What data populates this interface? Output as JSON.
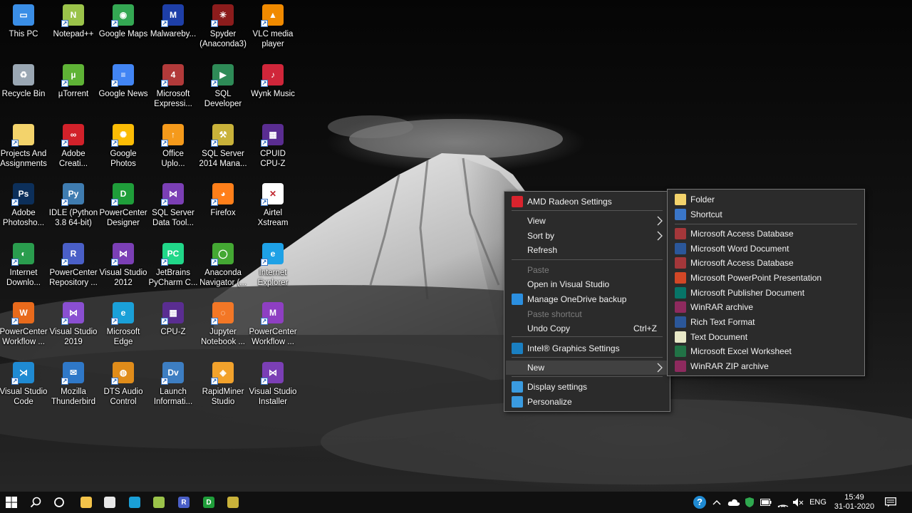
{
  "desktop": {
    "icons": [
      {
        "label": "This PC",
        "icon": "this-pc-icon",
        "color": "#3a8ee6",
        "glyph": "▭"
      },
      {
        "label": "Notepad++",
        "icon": "notepad-plus-plus-icon",
        "color": "#9bc34a",
        "glyph": "N"
      },
      {
        "label": "Google Maps",
        "icon": "google-maps-icon",
        "color": "#34a853",
        "glyph": "◉"
      },
      {
        "label": "Malwareby...",
        "icon": "malwarebytes-icon",
        "color": "#1e3fa8",
        "glyph": "M"
      },
      {
        "label": "Spyder\n(Anaconda3)",
        "icon": "spyder-icon",
        "color": "#8c1c1c",
        "glyph": "✳"
      },
      {
        "label": "VLC media\nplayer",
        "icon": "vlc-icon",
        "color": "#f08a00",
        "glyph": "▲"
      },
      {
        "label": "Recycle Bin",
        "icon": "recycle-bin-icon",
        "color": "#9aa7b3",
        "glyph": "♻"
      },
      {
        "label": "µTorrent",
        "icon": "utorrent-icon",
        "color": "#5fb336",
        "glyph": "µ"
      },
      {
        "label": "Google News",
        "icon": "google-news-icon",
        "color": "#4285f4",
        "glyph": "≡"
      },
      {
        "label": "Microsoft\nExpressi...",
        "icon": "microsoft-expression-icon",
        "color": "#b23a3a",
        "glyph": "4"
      },
      {
        "label": "SQL\nDeveloper",
        "icon": "sql-developer-icon",
        "color": "#2e8b57",
        "glyph": "▶"
      },
      {
        "label": "Wynk Music",
        "icon": "wynk-music-icon",
        "color": "#d0263a",
        "glyph": "♪"
      },
      {
        "label": "Projects And\nAssignments",
        "icon": "folder-icon",
        "color": "#f3d36b",
        "glyph": ""
      },
      {
        "label": "Adobe\nCreati...",
        "icon": "adobe-creative-cloud-icon",
        "color": "#d2212a",
        "glyph": "∞"
      },
      {
        "label": "Google\nPhotos",
        "icon": "google-photos-icon",
        "color": "#fbbc05",
        "glyph": "✺"
      },
      {
        "label": "Office\nUplo...",
        "icon": "office-upload-icon",
        "color": "#f59a1b",
        "glyph": "↑"
      },
      {
        "label": "SQL Server\n2014 Mana...",
        "icon": "sql-server-management-icon",
        "color": "#c9b23a",
        "glyph": "⚒"
      },
      {
        "label": "CPUID\nCPU-Z",
        "icon": "cpuid-icon",
        "color": "#5a2d91",
        "glyph": "▦"
      },
      {
        "label": "Adobe\nPhotosho...",
        "icon": "adobe-photoshop-icon",
        "color": "#0c2f5a",
        "glyph": "Ps"
      },
      {
        "label": "IDLE (Python\n3.8 64-bit)",
        "icon": "python-idle-icon",
        "color": "#3f7cb0",
        "glyph": "Py"
      },
      {
        "label": "PowerCenter\nDesigner",
        "icon": "powercenter-designer-icon",
        "color": "#1f9e3a",
        "glyph": "D"
      },
      {
        "label": "SQL Server\nData Tool...",
        "icon": "sql-server-data-tools-icon",
        "color": "#7b3fb5",
        "glyph": "⋈"
      },
      {
        "label": "Firefox",
        "icon": "firefox-icon",
        "color": "#ff7f1a",
        "glyph": "◕"
      },
      {
        "label": "Airtel\nXstream",
        "icon": "airtel-xstream-icon",
        "color": "#ffffff",
        "glyph": "✕"
      },
      {
        "label": "Internet\nDownlo...",
        "icon": "internet-download-manager-icon",
        "color": "#2a9d4e",
        "glyph": "◐"
      },
      {
        "label": "PowerCenter\nRepository ...",
        "icon": "powercenter-repository-icon",
        "color": "#4a5fc7",
        "glyph": "R"
      },
      {
        "label": "Visual Studio\n2012",
        "icon": "visual-studio-2012-icon",
        "color": "#7b3fb5",
        "glyph": "⋈"
      },
      {
        "label": "JetBrains\nPyCharm C...",
        "icon": "pycharm-icon",
        "color": "#21d789",
        "glyph": "PC"
      },
      {
        "label": "Anaconda\nNavigator (...",
        "icon": "anaconda-navigator-icon",
        "color": "#44a833",
        "glyph": "◯"
      },
      {
        "label": "Internet\nExplorer",
        "icon": "internet-explorer-icon",
        "color": "#1ea1e6",
        "glyph": "e"
      },
      {
        "label": "PowerCenter\nWorkflow ...",
        "icon": "powercenter-workflow-icon",
        "color": "#e86a1c",
        "glyph": "W"
      },
      {
        "label": "Visual Studio\n2019",
        "icon": "visual-studio-2019-icon",
        "color": "#8a4fd1",
        "glyph": "⋈"
      },
      {
        "label": "Microsoft\nEdge",
        "icon": "microsoft-edge-icon",
        "color": "#1aa0d8",
        "glyph": "e"
      },
      {
        "label": "CPU-Z",
        "icon": "cpu-z-icon",
        "color": "#5a2d91",
        "glyph": "▦"
      },
      {
        "label": "Jupyter\nNotebook ...",
        "icon": "jupyter-icon",
        "color": "#f37726",
        "glyph": "◌"
      },
      {
        "label": "PowerCenter\nWorkflow ...",
        "icon": "powercenter-workflow-monitor-icon",
        "color": "#8e3fc2",
        "glyph": "M"
      },
      {
        "label": "Visual Studio\nCode",
        "icon": "visual-studio-code-icon",
        "color": "#1f8ad2",
        "glyph": "⋊"
      },
      {
        "label": "Mozilla\nThunderbird",
        "icon": "thunderbird-icon",
        "color": "#2f78c8",
        "glyph": "✉"
      },
      {
        "label": "DTS Audio\nControl",
        "icon": "dts-audio-icon",
        "color": "#e08c1a",
        "glyph": "◍"
      },
      {
        "label": "Launch\nInformati...",
        "icon": "informatica-launch-icon",
        "color": "#3d7ec2",
        "glyph": "Dv"
      },
      {
        "label": "RapidMiner\nStudio",
        "icon": "rapidminer-icon",
        "color": "#f2a22c",
        "glyph": "◈"
      },
      {
        "label": "Visual Studio\nInstaller",
        "icon": "visual-studio-installer-icon",
        "color": "#7b3fb5",
        "glyph": "⋈"
      }
    ]
  },
  "context_menu": {
    "items": [
      {
        "label": "AMD Radeon Settings",
        "icon": "amd-radeon-icon",
        "color": "#d9232d"
      },
      {
        "label": "View",
        "submenu": true
      },
      {
        "label": "Sort by",
        "submenu": true
      },
      {
        "label": "Refresh"
      },
      {
        "label": "Paste",
        "disabled": true
      },
      {
        "label": "Open in Visual Studio"
      },
      {
        "label": "Manage OneDrive backup",
        "icon": "onedrive-icon",
        "color": "#2b8fe0"
      },
      {
        "label": "Paste shortcut",
        "disabled": true
      },
      {
        "label": "Undo Copy",
        "shortcut": "Ctrl+Z"
      },
      {
        "label": "Intel® Graphics Settings",
        "icon": "intel-graphics-icon",
        "color": "#1a7fc1"
      },
      {
        "label": "New",
        "submenu": true,
        "active": true
      },
      {
        "label": "Display settings",
        "icon": "display-settings-icon",
        "color": "#3a9be0"
      },
      {
        "label": "Personalize",
        "icon": "personalize-icon",
        "color": "#3a9be0"
      }
    ]
  },
  "new_submenu": {
    "items": [
      {
        "label": "Folder",
        "icon": "folder-icon",
        "color": "#f3d36b"
      },
      {
        "label": "Shortcut",
        "icon": "shortcut-icon",
        "color": "#3a76c8"
      },
      {
        "label": "Microsoft Access Database",
        "icon": "access-icon",
        "color": "#a4373a"
      },
      {
        "label": "Microsoft Word Document",
        "icon": "word-icon",
        "color": "#2b579a"
      },
      {
        "label": "Microsoft Access Database",
        "icon": "access-icon",
        "color": "#a4373a"
      },
      {
        "label": "Microsoft PowerPoint Presentation",
        "icon": "powerpoint-icon",
        "color": "#d24726"
      },
      {
        "label": "Microsoft Publisher Document",
        "icon": "publisher-icon",
        "color": "#077568"
      },
      {
        "label": "WinRAR archive",
        "icon": "winrar-icon",
        "color": "#8e2a5e"
      },
      {
        "label": "Rich Text Format",
        "icon": "rich-text-icon",
        "color": "#2b579a"
      },
      {
        "label": "Text Document",
        "icon": "text-document-icon",
        "color": "#e8e8c8"
      },
      {
        "label": "Microsoft Excel Worksheet",
        "icon": "excel-icon",
        "color": "#217346"
      },
      {
        "label": "WinRAR ZIP archive",
        "icon": "winrar-zip-icon",
        "color": "#8e2a5e"
      }
    ]
  },
  "taskbar": {
    "pinned": [
      {
        "icon": "start-icon"
      },
      {
        "icon": "search-icon"
      },
      {
        "icon": "cortana-icon"
      },
      {
        "icon": "file-explorer-icon",
        "color": "#f3c34a"
      },
      {
        "icon": "microsoft-store-icon",
        "color": "#e8e8e8"
      },
      {
        "icon": "edge-taskbar-icon",
        "color": "#1aa0d8"
      },
      {
        "icon": "notepad-plus-plus-taskbar-icon",
        "color": "#9bc34a"
      },
      {
        "icon": "powercenter-repository-taskbar-icon",
        "color": "#4a5fc7",
        "glyph": "R"
      },
      {
        "icon": "powercenter-designer-taskbar-icon",
        "color": "#1f9e3a",
        "glyph": "D"
      },
      {
        "icon": "sql-server-taskbar-icon",
        "color": "#c9b23a"
      }
    ],
    "tray": {
      "language": "ENG",
      "time": "15:49",
      "date": "31-01-2020"
    }
  }
}
